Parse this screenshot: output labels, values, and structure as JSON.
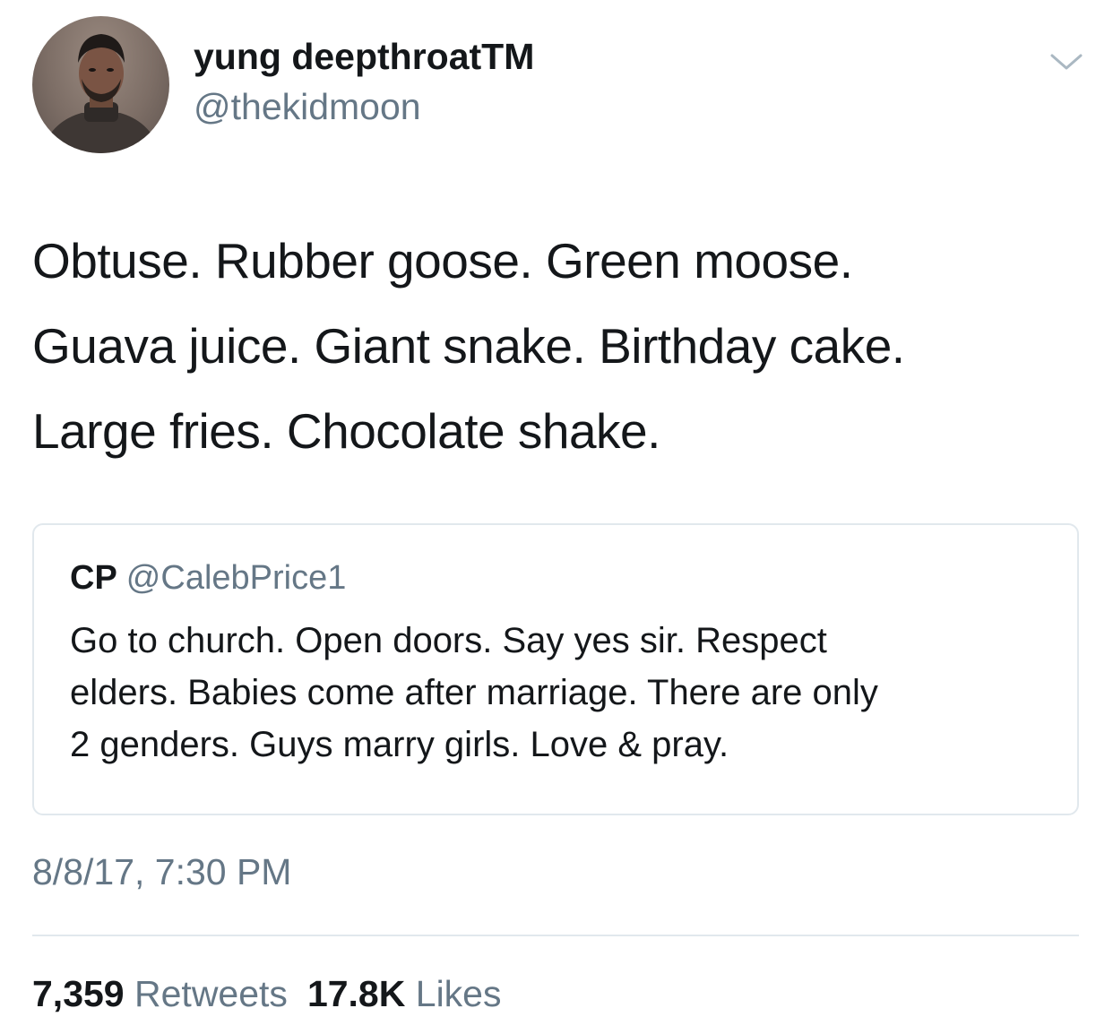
{
  "author": {
    "display_name": "yung deepthroatTM",
    "handle": "@thekidmoon",
    "avatar_icon": "profile-photo"
  },
  "tweet": {
    "lines": [
      "Obtuse. Rubber goose. Green moose.",
      "Guava juice. Giant snake. Birthday cake.",
      "Large fries. Chocolate shake."
    ]
  },
  "quoted_tweet": {
    "name": "CP",
    "handle": "@CalebPrice1",
    "lines": [
      "Go to church. Open doors. Say yes sir. Respect",
      "elders. Babies come after marriage. There are only",
      "2 genders. Guys marry girls. Love & pray."
    ]
  },
  "timestamp": "8/8/17, 7:30 PM",
  "stats": {
    "retweets_count": "7,359",
    "retweets_label": "Retweets",
    "likes_count": "17.8K",
    "likes_label": "Likes"
  },
  "colors": {
    "text": "#14171a",
    "secondary": "#657786",
    "border": "#e1e8ed"
  }
}
